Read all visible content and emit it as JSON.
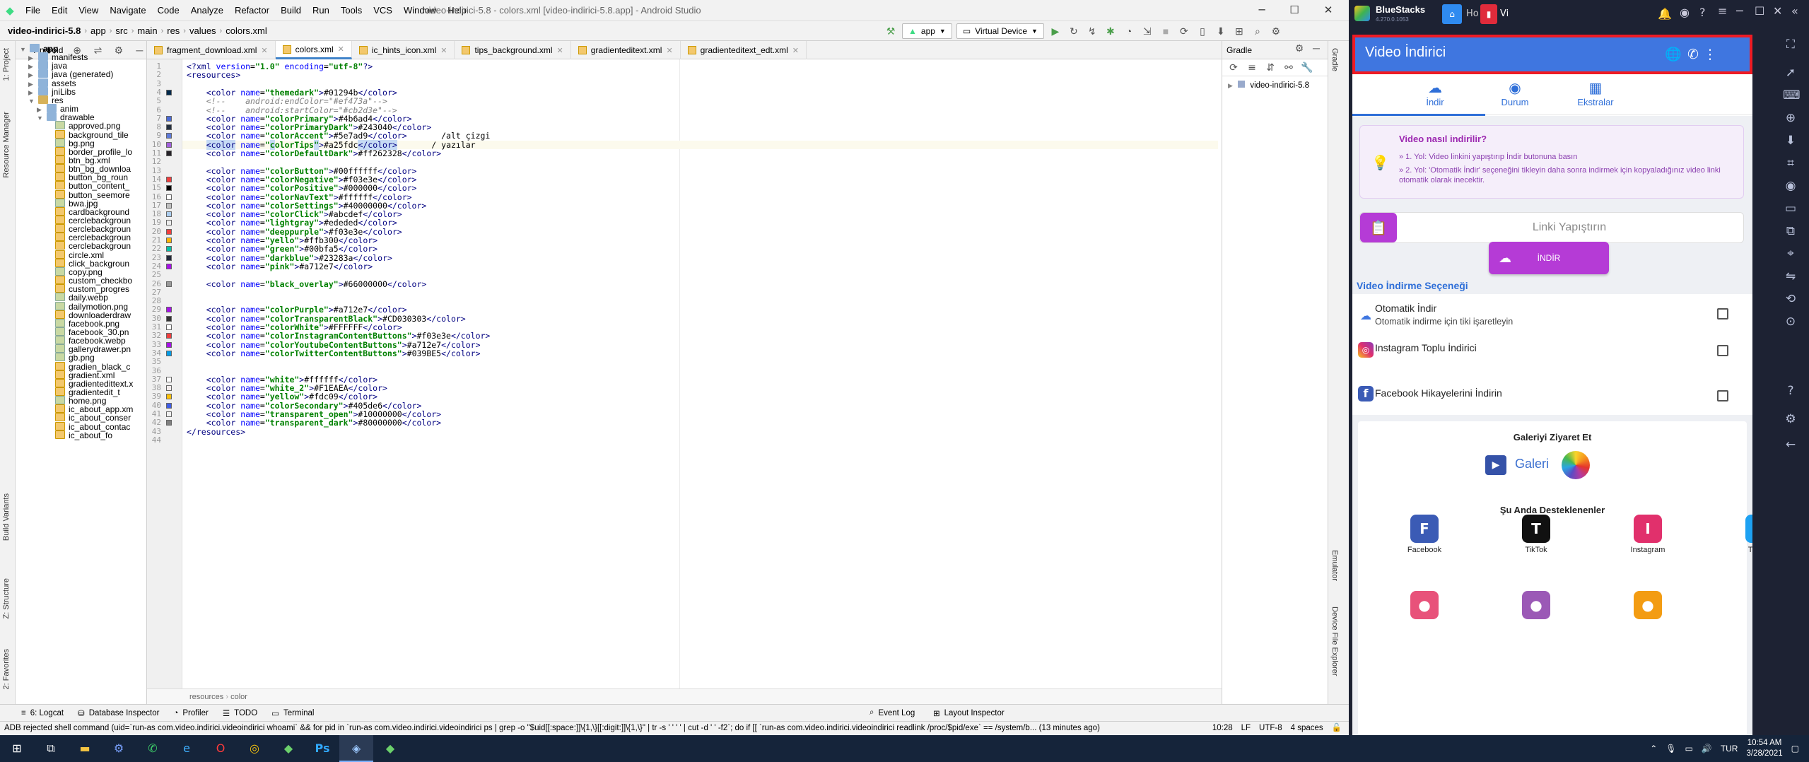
{
  "as": {
    "menu": [
      "File",
      "Edit",
      "View",
      "Navigate",
      "Code",
      "Analyze",
      "Refactor",
      "Build",
      "Run",
      "Tools",
      "VCS",
      "Window",
      "Help"
    ],
    "window_title": "video-indirici-5.8 - colors.xml [video-indirici-5.8.app] - Android Studio",
    "breadcrumb": [
      "video-indirici-5.8",
      "app",
      "src",
      "main",
      "res",
      "values",
      "colors.xml"
    ],
    "run_config": "app",
    "device": "Virtual Device",
    "left_strip_labels": [
      "1: Project",
      "Resource Manager",
      "Build Variants",
      "Z: Structure",
      "2: Favorites"
    ],
    "right_strip_labels": [
      "Gradle",
      "Emulator",
      "Device File Explorer"
    ],
    "project_header": "Android",
    "tree": [
      {
        "label": "app",
        "depth": 0,
        "type": "folder",
        "open": true,
        "bold": true
      },
      {
        "label": "manifests",
        "depth": 1,
        "type": "folder",
        "open": false
      },
      {
        "label": "java",
        "depth": 1,
        "type": "folder",
        "open": false
      },
      {
        "label": "java (generated)",
        "depth": 1,
        "type": "folder",
        "open": false
      },
      {
        "label": "assets",
        "depth": 1,
        "type": "folder",
        "open": false
      },
      {
        "label": "jniLibs",
        "depth": 1,
        "type": "folder",
        "open": false
      },
      {
        "label": "res",
        "depth": 1,
        "type": "folderY",
        "open": true
      },
      {
        "label": "anim",
        "depth": 2,
        "type": "folder",
        "open": false
      },
      {
        "label": "drawable",
        "depth": 2,
        "type": "folder",
        "open": true
      },
      {
        "label": "approved.png",
        "depth": 3,
        "type": "img"
      },
      {
        "label": "background_tile",
        "depth": 3,
        "type": "xml"
      },
      {
        "label": "bg.png",
        "depth": 3,
        "type": "img"
      },
      {
        "label": "border_profile_lo",
        "depth": 3,
        "type": "xml"
      },
      {
        "label": "btn_bg.xml",
        "depth": 3,
        "type": "xml"
      },
      {
        "label": "btn_bg_downloa",
        "depth": 3,
        "type": "xml"
      },
      {
        "label": "button_bg_roun",
        "depth": 3,
        "type": "xml"
      },
      {
        "label": "button_content_",
        "depth": 3,
        "type": "xml"
      },
      {
        "label": "button_seemore",
        "depth": 3,
        "type": "xml"
      },
      {
        "label": "bwa.jpg",
        "depth": 3,
        "type": "img"
      },
      {
        "label": "cardbackground",
        "depth": 3,
        "type": "xml"
      },
      {
        "label": "cerclebackgroun",
        "depth": 3,
        "type": "xml"
      },
      {
        "label": "cerclebackgroun",
        "depth": 3,
        "type": "xml"
      },
      {
        "label": "cerclebackgroun",
        "depth": 3,
        "type": "xml"
      },
      {
        "label": "cerclebackgroun",
        "depth": 3,
        "type": "xml"
      },
      {
        "label": "circle.xml",
        "depth": 3,
        "type": "xml"
      },
      {
        "label": "click_backgroun",
        "depth": 3,
        "type": "xml"
      },
      {
        "label": "copy.png",
        "depth": 3,
        "type": "img"
      },
      {
        "label": "custom_checkbo",
        "depth": 3,
        "type": "xml"
      },
      {
        "label": "custom_progres",
        "depth": 3,
        "type": "xml"
      },
      {
        "label": "daily.webp",
        "depth": 3,
        "type": "img"
      },
      {
        "label": "dailymotion.png",
        "depth": 3,
        "type": "img"
      },
      {
        "label": "downloaderdraw",
        "depth": 3,
        "type": "xml"
      },
      {
        "label": "facebook.png",
        "depth": 3,
        "type": "img"
      },
      {
        "label": "facebook_30.pn",
        "depth": 3,
        "type": "img"
      },
      {
        "label": "facebook.webp",
        "depth": 3,
        "type": "img"
      },
      {
        "label": "gallerydrawer.pn",
        "depth": 3,
        "type": "img"
      },
      {
        "label": "gb.png",
        "depth": 3,
        "type": "img"
      },
      {
        "label": "gradien_black_c",
        "depth": 3,
        "type": "xml"
      },
      {
        "label": "gradient.xml",
        "depth": 3,
        "type": "xml"
      },
      {
        "label": "gradientedittext.x",
        "depth": 3,
        "type": "xml"
      },
      {
        "label": "gradientedit_t",
        "depth": 3,
        "type": "xml"
      },
      {
        "label": "home.png",
        "depth": 3,
        "type": "img"
      },
      {
        "label": "ic_about_app.xm",
        "depth": 3,
        "type": "xml"
      },
      {
        "label": "ic_about_conser",
        "depth": 3,
        "type": "xml"
      },
      {
        "label": "ic_about_contac",
        "depth": 3,
        "type": "xml"
      },
      {
        "label": "ic_about_fo",
        "depth": 3,
        "type": "xml"
      }
    ],
    "tabs": [
      {
        "label": "fragment_download.xml",
        "active": false
      },
      {
        "label": "colors.xml",
        "active": true
      },
      {
        "label": "ic_hints_icon.xml",
        "active": false
      },
      {
        "label": "tips_background.xml",
        "active": false
      },
      {
        "label": "gradienteditext.xml",
        "active": false
      },
      {
        "label": "gradienteditext_edt.xml",
        "active": false
      }
    ],
    "code_lines": [
      {
        "n": 1,
        "text": "<?xml version=\"1.0\" encoding=\"utf-8\"?>",
        "kind": "decl"
      },
      {
        "n": 2,
        "text": "<resources>",
        "kind": "tag"
      },
      {
        "n": 3,
        "text": "",
        "kind": "blank"
      },
      {
        "n": 4,
        "name": "themedark",
        "value": "#01294b",
        "swatch": "#01294b"
      },
      {
        "n": 5,
        "text": "    <!--    android:endColor=\"#ef473a\"-->",
        "kind": "comment"
      },
      {
        "n": 6,
        "text": "    <!--    android:startColor=\"#cb2d3e\"-->",
        "kind": "comment"
      },
      {
        "n": 7,
        "name": "colorPrimary",
        "value": "#4b6ad4",
        "swatch": "#4b6ad4"
      },
      {
        "n": 8,
        "name": "colorPrimaryDark",
        "value": "#243040",
        "swatch": "#243040"
      },
      {
        "n": 9,
        "name": "colorAccent",
        "value": "#5e7ad9",
        "swatch": "#5e7ad9",
        "trail": "       /alt çizgi"
      },
      {
        "n": 10,
        "name": "colorTips",
        "value": "#a25fdc",
        "swatch": "#a25fdc",
        "trail": "       / yazılar",
        "highlight": true
      },
      {
        "n": 11,
        "name": "colorDefaultDark",
        "value": "#ff262328",
        "swatch": "#262328"
      },
      {
        "n": 12,
        "text": "",
        "kind": "blank"
      },
      {
        "n": 13,
        "name": "colorButton",
        "value": "#00ffffff",
        "swatch": ""
      },
      {
        "n": 14,
        "name": "colorNegative",
        "value": "#f03e3e",
        "swatch": "#f03e3e"
      },
      {
        "n": 15,
        "name": "colorPositive",
        "value": "#000000",
        "swatch": "#000000"
      },
      {
        "n": 16,
        "name": "colorNavText",
        "value": "#ffffff",
        "swatch": "#ffffff"
      },
      {
        "n": 17,
        "name": "colorSettings",
        "value": "#40000000",
        "swatch": "#bfbfbf"
      },
      {
        "n": 18,
        "name": "colorClick",
        "value": "#abcdef",
        "swatch": "#abcdef"
      },
      {
        "n": 19,
        "name": "lightgray",
        "value": "#ededed",
        "swatch": "#ededed"
      },
      {
        "n": 20,
        "name": "deeppurple",
        "value": "#f03e3e",
        "swatch": "#f03e3e"
      },
      {
        "n": 21,
        "name": "yello",
        "value": "#ffb300",
        "swatch": "#ffb300"
      },
      {
        "n": 22,
        "name": "green",
        "value": "#00bfa5",
        "swatch": "#00bfa5"
      },
      {
        "n": 23,
        "name": "darkblue",
        "value": "#23283a",
        "swatch": "#23283a"
      },
      {
        "n": 24,
        "name": "pink",
        "value": "#a712e7",
        "swatch": "#a712e7"
      },
      {
        "n": 25,
        "text": "",
        "kind": "blank"
      },
      {
        "n": 26,
        "name": "black_overlay",
        "value": "#66000000",
        "swatch": "#999999"
      },
      {
        "n": 27,
        "text": "",
        "kind": "blank"
      },
      {
        "n": 28,
        "text": "",
        "kind": "blank"
      },
      {
        "n": 29,
        "name": "colorPurple",
        "value": "#a712e7",
        "swatch": "#a712e7"
      },
      {
        "n": 30,
        "name": "colorTransparentBlack",
        "value": "#CD030303",
        "swatch": "#333333"
      },
      {
        "n": 31,
        "name": "colorWhite",
        "value": "#FFFFFF",
        "swatch": "#ffffff"
      },
      {
        "n": 32,
        "name": "colorInstagramContentButtons",
        "value": "#f03e3e",
        "swatch": "#f03e3e"
      },
      {
        "n": 33,
        "name": "colorYoutubeContentButtons",
        "value": "#a712e7",
        "swatch": "#a712e7"
      },
      {
        "n": 34,
        "name": "colorTwitterContentButtons",
        "value": "#039BE5",
        "swatch": "#039BE5"
      },
      {
        "n": 35,
        "text": "",
        "kind": "blank"
      },
      {
        "n": 36,
        "text": "",
        "kind": "blank"
      },
      {
        "n": 37,
        "name": "white",
        "value": "#ffffff",
        "swatch": "#ffffff"
      },
      {
        "n": 38,
        "name": "white_2",
        "value": "#F1EAEA",
        "swatch": "#F1EAEA"
      },
      {
        "n": 39,
        "name": "yellow",
        "value": "#fdc09",
        "swatch": "#fdc009"
      },
      {
        "n": 40,
        "name": "colorSecondary",
        "value": "#405de6",
        "swatch": "#405de6"
      },
      {
        "n": 41,
        "name": "transparent_open",
        "value": "#10000000",
        "swatch": "#eeeeee"
      },
      {
        "n": 42,
        "name": "transparent_dark",
        "value": "#80000000",
        "swatch": "#808080"
      },
      {
        "n": 43,
        "text": "</resources>",
        "kind": "tag"
      },
      {
        "n": 44,
        "text": "",
        "kind": "blank"
      }
    ],
    "editor_breadcrumb": [
      "resources",
      "color"
    ],
    "gradle_title": "Gradle",
    "gradle_tree_item": "video-indirici-5.8",
    "bottom_tools": [
      "6: Logcat",
      "Database Inspector",
      "Profiler",
      "TODO",
      "Terminal"
    ],
    "bottom_right_tools": [
      "Event Log",
      "Layout Inspector"
    ],
    "status_message": "ADB rejected shell command (uid=`run-as com.video.indirici.videoindirici whoami` && for pid in `run-as com.video.indirici.videoindirici ps | grep -o \"$uid[[:space:]]\\{1,\\}[[:digit:]]\\{1,\\}\" | tr -s ' ' ' ' | cut -d ' ' -f2`; do   if [[ `run-as com.video.indirici.videoindirici readlink /proc/$pid/exe` == /system/b... (13 minutes ago)",
    "status_right": [
      "10:28",
      "LF",
      "UTF-8",
      "4 spaces"
    ]
  },
  "bluestacks": {
    "brand": "BlueStacks",
    "version": "4.270.0.1053",
    "tabs": [
      "Ho",
      "Vi"
    ],
    "app": {
      "title": "Video İndirici",
      "tabs": [
        "İndir",
        "Durum",
        "Ekstralar"
      ],
      "howto_title": "Video nasıl indirilir?",
      "howto_step1": "» 1. Yol: Video linkini yapıştırıp İndir butonuna basın",
      "howto_step2": "» 2. Yol: 'Otomatik İndir' seçeneğini tikleyin daha sonra indirmek için kopyaladığınız video linki otomatik olarak inecektir.",
      "paste_placeholder": "Linki Yapıştırın",
      "download_button": "İNDİR",
      "options_title": "Video İndirme Seçeneği",
      "options": [
        {
          "title": "Otomatik İndir",
          "subtitle": "Otomatik indirme için tiki işaretleyin"
        },
        {
          "title": "Instagram Toplu İndirici",
          "subtitle": ""
        },
        {
          "title": "Facebook Hikayelerini İndirin",
          "subtitle": ""
        }
      ],
      "gallery_title": "Galeriyi Ziyaret Et",
      "gallery_label": "Galeri",
      "supported_title": "Şu Anda Desteklenenler",
      "platforms": [
        {
          "name": "Facebook",
          "color": "#3b5bb5"
        },
        {
          "name": "TikTok",
          "color": "#111111"
        },
        {
          "name": "Instagram",
          "color": "#e1306c"
        },
        {
          "name": "Twitter",
          "color": "#1da1f2"
        },
        {
          "name": "",
          "color": "#e8527a"
        },
        {
          "name": "",
          "color": "#9b59b6"
        },
        {
          "name": "",
          "color": "#f39c12"
        }
      ]
    }
  },
  "taskbar": {
    "time": "10:54 AM",
    "date": "3/28/2021",
    "lang": "TUR"
  }
}
